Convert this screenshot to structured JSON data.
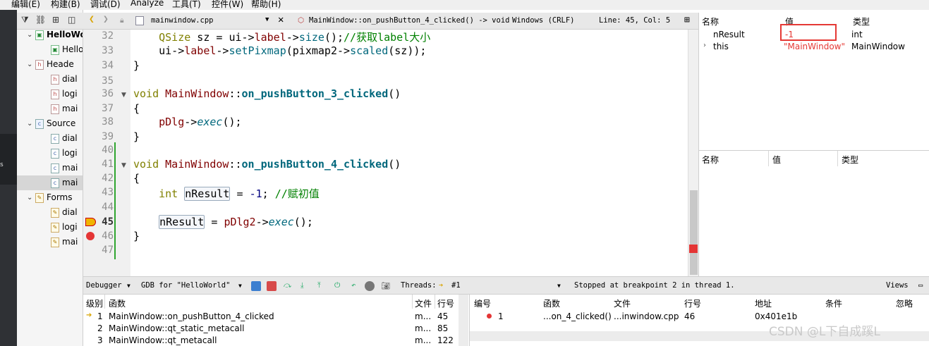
{
  "menu": [
    "编辑(E)",
    "构建(B)",
    "调试(D)",
    "Analyze",
    "工具(T)",
    "控件(W)",
    "帮助(H)"
  ],
  "project_tree": {
    "rows": [
      {
        "label": "HelloWo",
        "icon": "pro",
        "bold": true
      },
      {
        "label": "HelloW",
        "icon": "pro"
      },
      {
        "label": "Heade",
        "icon": "h-folder",
        "expanded": true
      },
      {
        "label": "dial",
        "icon": "h"
      },
      {
        "label": "logi",
        "icon": "h"
      },
      {
        "label": "mai",
        "icon": "h"
      },
      {
        "label": "Source",
        "icon": "src-folder",
        "expanded": true
      },
      {
        "label": "dial",
        "icon": "c"
      },
      {
        "label": "logi",
        "icon": "c"
      },
      {
        "label": "mai",
        "icon": "c"
      },
      {
        "label": "mai",
        "icon": "c",
        "selected": true
      },
      {
        "label": "Forms",
        "icon": "ui-folder",
        "expanded": true
      },
      {
        "label": "dial",
        "icon": "ui"
      },
      {
        "label": "logi",
        "icon": "ui"
      },
      {
        "label": "mai",
        "icon": "ui"
      }
    ]
  },
  "editor_toolbar": {
    "file": "mainwindow.cpp",
    "function": "MainWindow::on_pushButton_4_clicked() -> void",
    "line_ending": "Windows (CRLF)",
    "position": "Line: 45, Col: 5"
  },
  "code": {
    "line_numbers": [
      "32",
      "33",
      "34",
      "35",
      "36",
      "37",
      "38",
      "39",
      "40",
      "41",
      "42",
      "43",
      "44",
      "45",
      "46",
      "47"
    ],
    "lines": [
      {
        "parts": [
          {
            "t": "    "
          },
          {
            "t": "QSize",
            "c": "kw"
          },
          {
            "t": " sz = ui->"
          },
          {
            "t": "label",
            "c": "mem"
          },
          {
            "t": "->"
          },
          {
            "t": "size",
            "c": "fn"
          },
          {
            "t": "();"
          },
          {
            "t": "//获取label大小",
            "c": "cm"
          }
        ]
      },
      {
        "parts": [
          {
            "t": "    ui->"
          },
          {
            "t": "label",
            "c": "mem"
          },
          {
            "t": "->"
          },
          {
            "t": "setPixmap",
            "c": "fn"
          },
          {
            "t": "(pixmap2->"
          },
          {
            "t": "scaled",
            "c": "fn"
          },
          {
            "t": "(sz));"
          }
        ]
      },
      {
        "parts": [
          {
            "t": "}"
          }
        ]
      },
      {
        "parts": [
          {
            "t": ""
          }
        ]
      },
      {
        "parts": [
          {
            "t": "void",
            "c": "kw"
          },
          {
            "t": " "
          },
          {
            "t": "MainWindow",
            "c": "mem"
          },
          {
            "t": "::"
          },
          {
            "t": "on_pushButton_3_clicked",
            "c": "fnb"
          },
          {
            "t": "()"
          }
        ]
      },
      {
        "parts": [
          {
            "t": "{"
          }
        ]
      },
      {
        "parts": [
          {
            "t": "    "
          },
          {
            "t": "pDlg",
            "c": "mem"
          },
          {
            "t": "->"
          },
          {
            "t": "exec",
            "c": "it"
          },
          {
            "t": "();"
          }
        ]
      },
      {
        "parts": [
          {
            "t": "}"
          }
        ]
      },
      {
        "parts": [
          {
            "t": ""
          }
        ]
      },
      {
        "parts": [
          {
            "t": "void",
            "c": "kw"
          },
          {
            "t": " "
          },
          {
            "t": "MainWindow",
            "c": "mem"
          },
          {
            "t": "::"
          },
          {
            "t": "on_pushButton_4_clicked",
            "c": "fnb"
          },
          {
            "t": "()"
          }
        ]
      },
      {
        "parts": [
          {
            "t": "{"
          }
        ]
      },
      {
        "parts": [
          {
            "t": "    "
          },
          {
            "t": "int",
            "c": "kw"
          },
          {
            "t": " "
          },
          {
            "t": "nResult",
            "c": "hl"
          },
          {
            "t": " = "
          },
          {
            "t": "-1",
            "c": "num"
          },
          {
            "t": "; "
          },
          {
            "t": "//赋初值",
            "c": "cm"
          }
        ]
      },
      {
        "parts": [
          {
            "t": ""
          }
        ]
      },
      {
        "parts": [
          {
            "t": "    "
          },
          {
            "t": "nResult",
            "c": "hl"
          },
          {
            "t": " = "
          },
          {
            "t": "pDlg2",
            "c": "mem"
          },
          {
            "t": "->"
          },
          {
            "t": "exec",
            "c": "it"
          },
          {
            "t": "();"
          }
        ]
      },
      {
        "parts": [
          {
            "t": "}"
          }
        ]
      },
      {
        "parts": [
          {
            "t": ""
          }
        ]
      }
    ]
  },
  "locals": {
    "headers": [
      "名称",
      "值",
      "类型"
    ],
    "rows": [
      {
        "name": "nResult",
        "value": "-1",
        "type": "int"
      },
      {
        "name": "this",
        "value": "\"MainWindow\"",
        "type": "MainWindow"
      }
    ]
  },
  "watch": {
    "headers": [
      "名称",
      "值",
      "类型"
    ]
  },
  "debug_toolbar": {
    "debugger": "Debugger",
    "gdb": "GDB for \"HelloWorld\"",
    "threads_label": "Threads:",
    "thread": "#1",
    "status": "Stopped at breakpoint 2 in thread 1.",
    "views": "Views"
  },
  "stack": {
    "headers": [
      "级别",
      "函数",
      "文件",
      "行号"
    ],
    "rows": [
      {
        "level": "1",
        "function": "MainWindow::on_pushButton_4_clicked",
        "file": "m...",
        "line": "45"
      },
      {
        "level": "2",
        "function": "MainWindow::qt_static_metacall",
        "file": "m...",
        "line": "85"
      },
      {
        "level": "3",
        "function": "MainWindow::qt_metacall",
        "file": "m...",
        "line": "122"
      }
    ]
  },
  "breakpoints": {
    "headers": [
      "编号",
      "函数",
      "文件",
      "行号",
      "地址",
      "条件",
      "忽略"
    ],
    "rows": [
      {
        "number": "1",
        "function": "...on_4_clicked()",
        "file": "...inwindow.cpp",
        "line": "46",
        "address": "0x401e1b"
      }
    ]
  },
  "watermark": "CSDN @L下自成蹊L",
  "colors": {
    "breakpoint": "#e43535",
    "highlight_box": "#e53935",
    "change_bar": "#2fa52f"
  }
}
